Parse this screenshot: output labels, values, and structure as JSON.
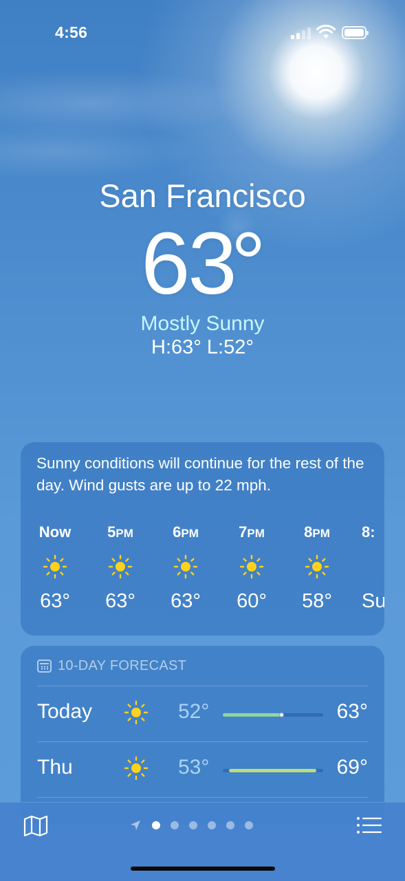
{
  "status_bar": {
    "time": "4:56"
  },
  "location": {
    "city": "San Francisco",
    "temperature": "63",
    "degree_symbol": "°",
    "condition": "Mostly Sunny",
    "high_low": "H:63°  L:52°"
  },
  "hourly": {
    "summary": "Sunny conditions will continue for the rest of the day. Wind gusts are up to 22 mph.",
    "items": [
      {
        "label": "Now",
        "suffix": "",
        "icon": "sun-icon",
        "temp": "63°"
      },
      {
        "label": "5",
        "suffix": "PM",
        "icon": "sun-icon",
        "temp": "63°"
      },
      {
        "label": "6",
        "suffix": "PM",
        "icon": "sun-icon",
        "temp": "63°"
      },
      {
        "label": "7",
        "suffix": "PM",
        "icon": "sun-icon",
        "temp": "60°"
      },
      {
        "label": "8",
        "suffix": "PM",
        "icon": "sun-icon",
        "temp": "58°"
      },
      {
        "label": "8:",
        "suffix": "",
        "icon": "sunset-icon",
        "temp": "Su"
      }
    ]
  },
  "forecast": {
    "title": "10-DAY FORECAST",
    "days": [
      {
        "day": "Today",
        "icon": "sun-icon",
        "low": "52°",
        "high": "63°",
        "range_start": 0.0,
        "range_end": 0.58,
        "current": 0.58,
        "bar_color": "#8fd6a0"
      },
      {
        "day": "Thu",
        "icon": "sun-icon",
        "low": "53°",
        "high": "69°",
        "range_start": 0.06,
        "range_end": 0.93,
        "bar_color": "#b8dc7c"
      }
    ]
  },
  "tab_bar": {
    "map_icon": "map-icon",
    "location_icon": "location-arrow-icon",
    "page_count": 6,
    "active_page": 0,
    "list_icon": "list-icon"
  },
  "colors": {
    "sun": "#ffd21a",
    "condition_text": "#c7f6ff"
  }
}
